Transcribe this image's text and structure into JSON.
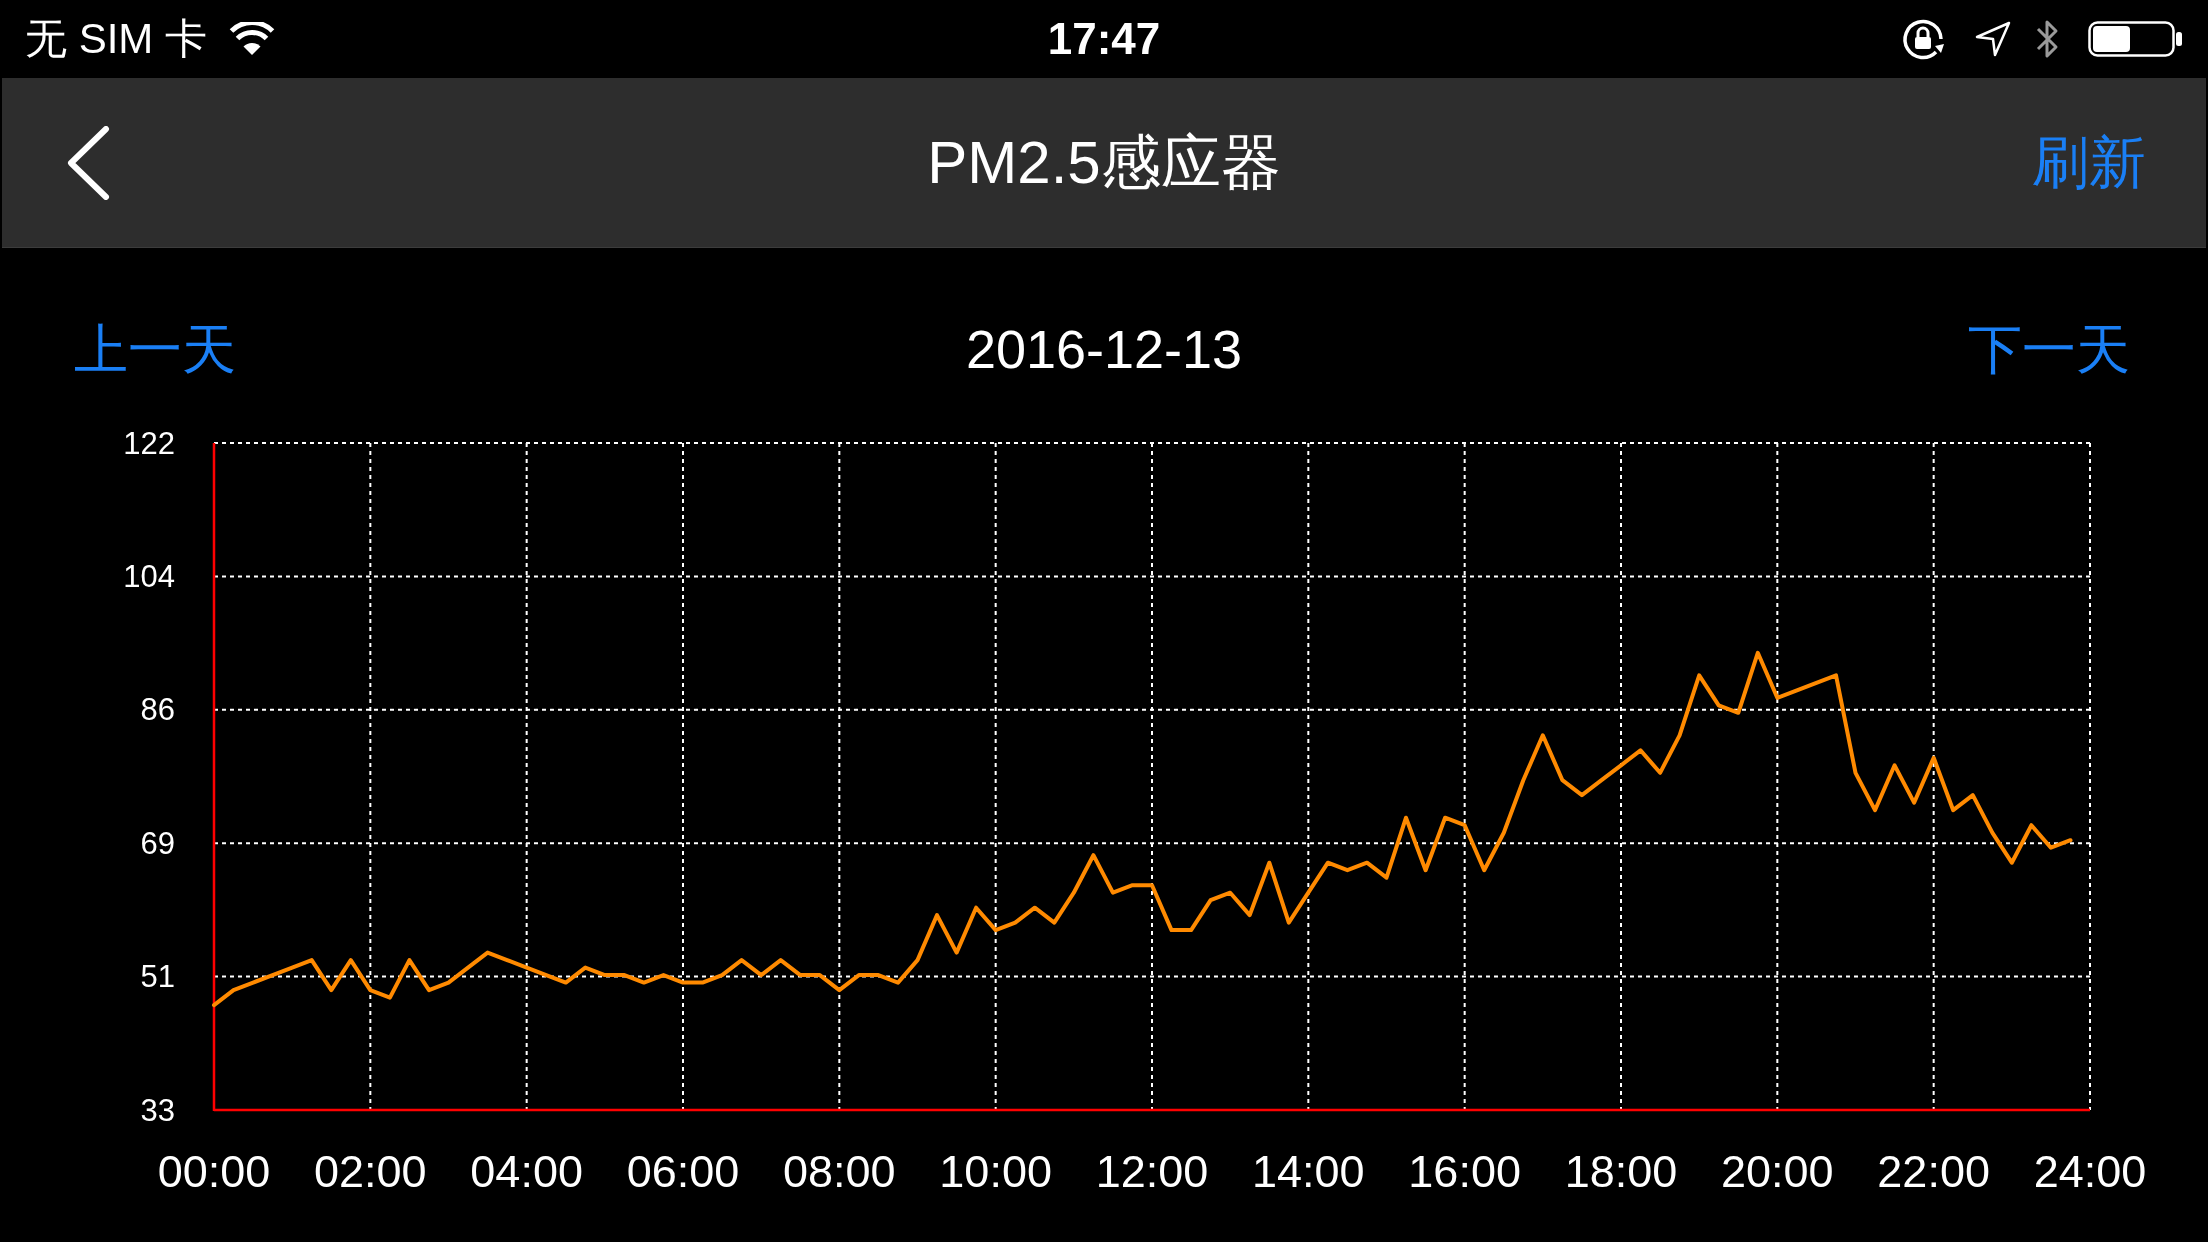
{
  "status_bar": {
    "carrier": "无 SIM 卡",
    "time": "17:47"
  },
  "nav_bar": {
    "title": "PM2.5感应器",
    "action": "刷新"
  },
  "date_nav": {
    "previous": "上一天",
    "date": "2016-12-13",
    "next": "下一天"
  },
  "chart": {
    "chart_data": {
      "type": "line",
      "x": [
        0,
        0.25,
        0.5,
        0.75,
        1,
        1.25,
        1.5,
        1.75,
        2,
        2.25,
        2.5,
        2.75,
        3,
        3.25,
        3.5,
        3.75,
        4,
        4.25,
        4.5,
        4.75,
        5,
        5.25,
        5.5,
        5.75,
        6,
        6.25,
        6.5,
        6.75,
        7,
        7.25,
        7.5,
        7.75,
        8,
        8.25,
        8.5,
        8.75,
        9,
        9.25,
        9.5,
        9.75,
        10,
        10.25,
        10.5,
        10.75,
        11,
        11.25,
        11.5,
        11.75,
        12,
        12.25,
        12.5,
        12.75,
        13,
        13.25,
        13.5,
        13.75,
        14,
        14.25,
        14.5,
        14.75,
        15,
        15.25,
        15.5,
        15.75,
        16,
        16.25,
        16.5,
        16.75,
        17,
        17.25,
        17.5,
        17.75,
        18,
        18.25,
        18.5,
        18.75,
        19,
        19.25,
        19.5,
        19.75,
        20,
        20.25,
        20.5,
        20.75,
        21,
        21.25,
        21.5,
        21.75,
        22,
        22.25,
        22.5,
        22.75,
        23,
        23.25,
        23.5,
        23.75
      ],
      "series": [
        {
          "color": "#ff8a00",
          "values": [
            47,
            49,
            50,
            51,
            52,
            53,
            49,
            53,
            49,
            48,
            53,
            49,
            50,
            52,
            54,
            53,
            52,
            51,
            50,
            52,
            51,
            51,
            50,
            51,
            50,
            50,
            51,
            53,
            51,
            53,
            51,
            51,
            49,
            51,
            51,
            50,
            53,
            59,
            54,
            60,
            57,
            58,
            60,
            58,
            62,
            67,
            62,
            63,
            63,
            57,
            57,
            61,
            62,
            59,
            66,
            58,
            62,
            66,
            65,
            66,
            64,
            72,
            65,
            72,
            71,
            65,
            70,
            77,
            83,
            77,
            75,
            77,
            79,
            81,
            78,
            83,
            91,
            87,
            86,
            94,
            88,
            89,
            90,
            91,
            78,
            73,
            79,
            74,
            80,
            73,
            75,
            70,
            66,
            71,
            68,
            69
          ]
        }
      ],
      "xlim": [
        0,
        24
      ],
      "ylim": [
        33,
        122
      ],
      "xticks": [
        {
          "value": 0,
          "label": "00:00"
        },
        {
          "value": 2,
          "label": "02:00"
        },
        {
          "value": 4,
          "label": "04:00"
        },
        {
          "value": 6,
          "label": "06:00"
        },
        {
          "value": 8,
          "label": "08:00"
        },
        {
          "value": 10,
          "label": "10:00"
        },
        {
          "value": 12,
          "label": "12:00"
        },
        {
          "value": 14,
          "label": "14:00"
        },
        {
          "value": 16,
          "label": "16:00"
        },
        {
          "value": 18,
          "label": "18:00"
        },
        {
          "value": 20,
          "label": "20:00"
        },
        {
          "value": 22,
          "label": "22:00"
        },
        {
          "value": 24,
          "label": "24:00"
        }
      ],
      "yticks": [
        {
          "value": 33,
          "label": "33"
        },
        {
          "value": 50.8,
          "label": "51"
        },
        {
          "value": 68.6,
          "label": "69"
        },
        {
          "value": 86.4,
          "label": "86"
        },
        {
          "value": 104.2,
          "label": "104"
        },
        {
          "value": 122,
          "label": "122"
        }
      ],
      "grid": true
    }
  }
}
